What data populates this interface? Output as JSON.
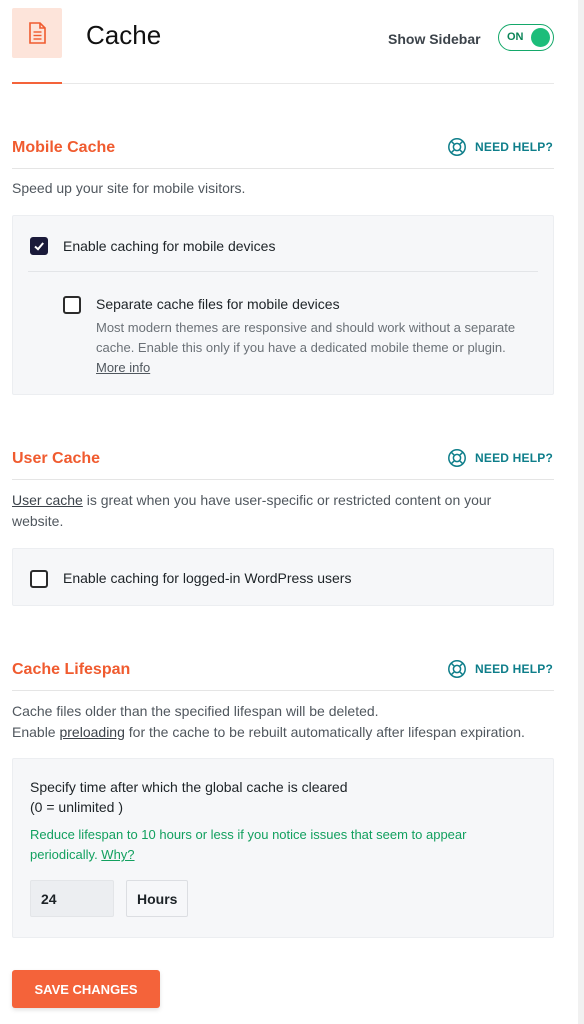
{
  "header": {
    "title": "Cache",
    "sidebar_label": "Show Sidebar",
    "toggle_state": "ON"
  },
  "help_label": "NEED HELP?",
  "mobile": {
    "title": "Mobile Cache",
    "description": "Speed up your site for mobile visitors.",
    "enable_label": "Enable caching for mobile devices",
    "enable_checked": true,
    "separate_label": "Separate cache files for mobile devices",
    "separate_checked": false,
    "separate_desc_1": "Most modern themes are responsive and should work without a separate",
    "separate_desc_2": "cache. Enable this only if you have a dedicated mobile theme or plugin.",
    "more_info": "More info"
  },
  "user": {
    "title": "User Cache",
    "desc_link": "User cache",
    "desc_rest": " is great when you have user-specific or restricted content on your",
    "desc_line2": "website.",
    "enable_label": "Enable caching for logged-in WordPress users",
    "enable_checked": false
  },
  "lifespan": {
    "title": "Cache Lifespan",
    "desc_line1": "Cache files older than the specified lifespan will be deleted.",
    "desc_line2_pre": "Enable ",
    "desc_line2_link": "preloading",
    "desc_line2_post": " for the cache to be rebuilt automatically after lifespan expiration.",
    "panel_title_1": "Specify time after which the global cache is cleared",
    "panel_title_2": "(0 = unlimited )",
    "note_line1": "Reduce lifespan to 10 hours or less if you notice issues that seem to appear",
    "note_line2_pre": "periodically. ",
    "note_link": "Why?",
    "value": "24",
    "unit": "Hours"
  },
  "save_label": "SAVE CHANGES",
  "colors": {
    "accent": "#f4633a",
    "toggle_green": "#1cbd7a",
    "help_teal": "#0e7e8a",
    "note_green": "#12a05f"
  },
  "icons": {
    "page": "document-icon",
    "help": "lifebuoy-icon",
    "check": "checkmark-icon"
  }
}
